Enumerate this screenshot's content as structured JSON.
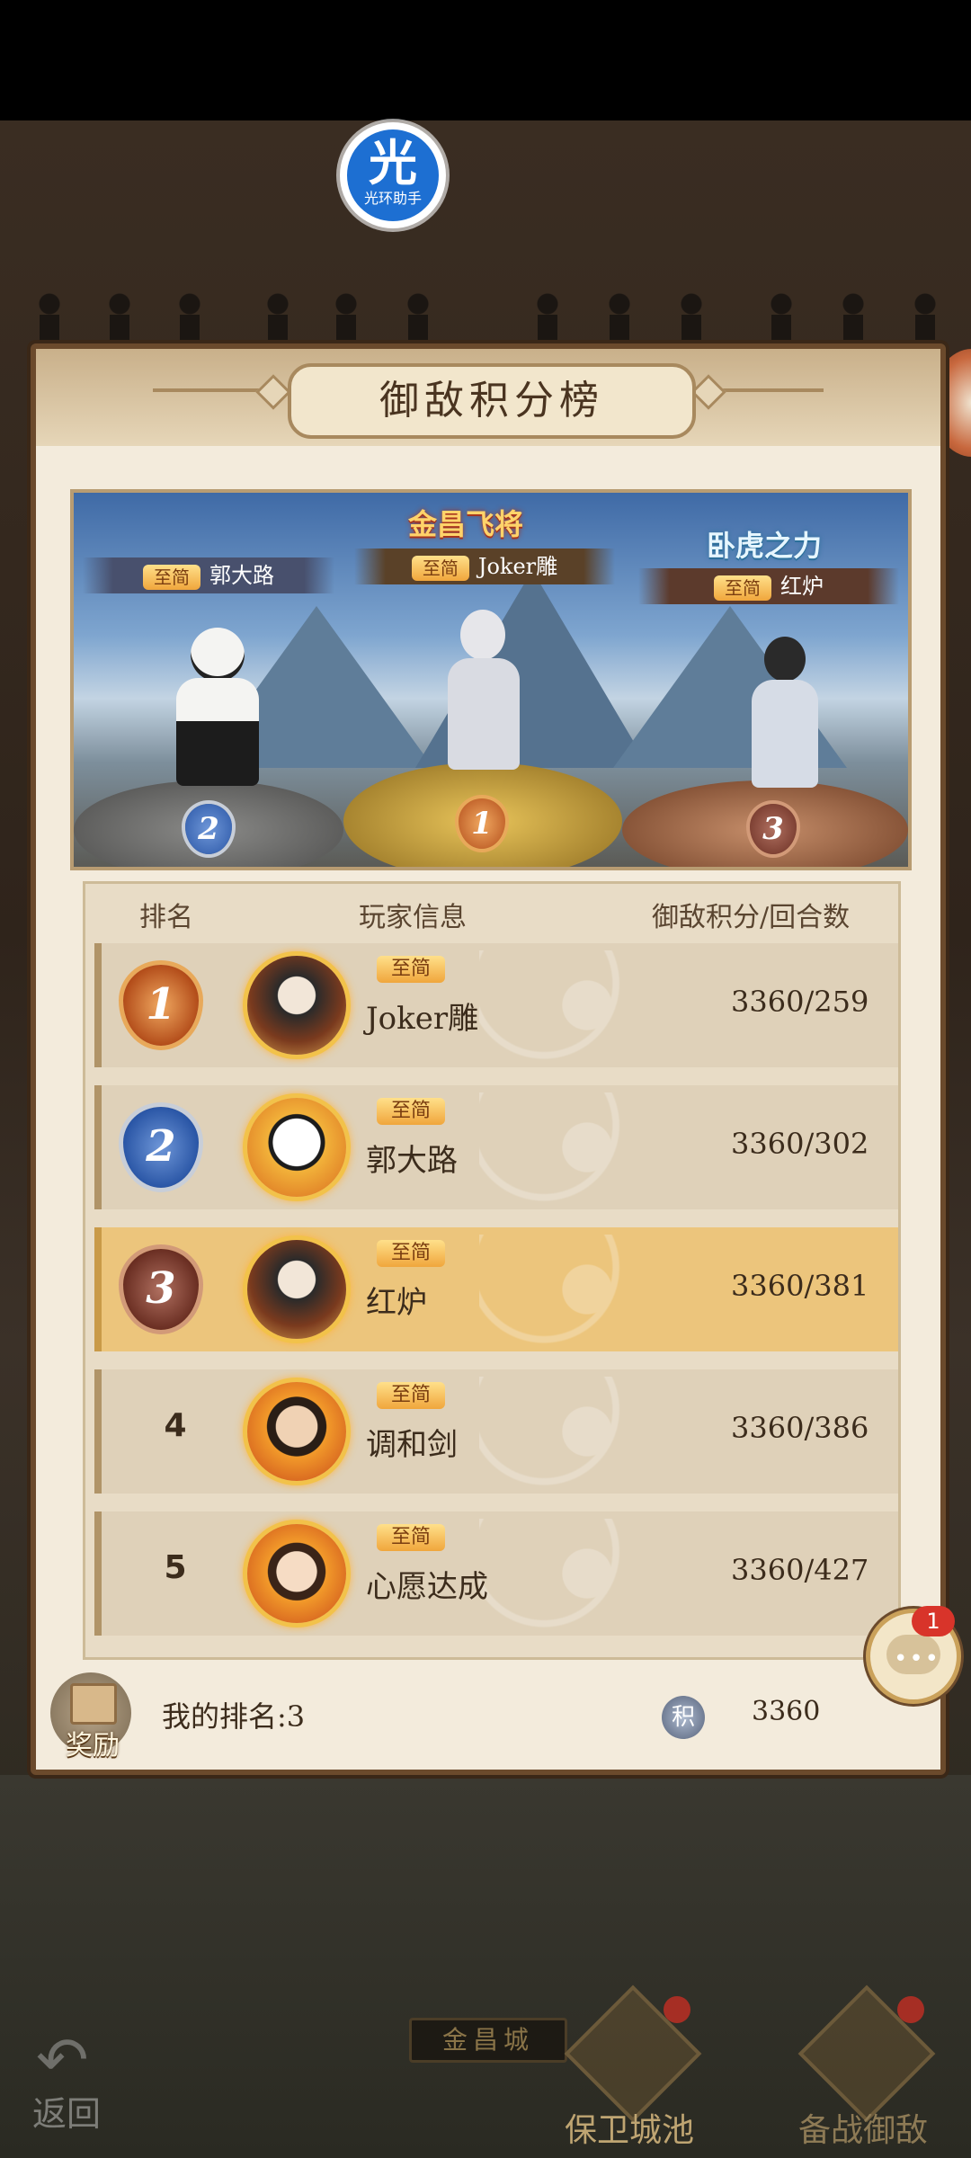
{
  "helper": {
    "glyph": "光",
    "label": "光环助手"
  },
  "panel": {
    "title": "御敌积分榜"
  },
  "podium": {
    "first": {
      "title": "金昌飞将",
      "vip": "至简",
      "name": "Joker雕",
      "rank": "1"
    },
    "second": {
      "vip": "至简",
      "name": "郭大路",
      "rank": "2"
    },
    "third": {
      "title": "卧虎之力",
      "vip": "至简",
      "name": "红炉",
      "rank": "3"
    }
  },
  "table": {
    "headers": {
      "rank": "排名",
      "player": "玩家信息",
      "score": "御敌积分/回合数"
    },
    "rows": [
      {
        "rank": "1",
        "vip": "至简",
        "name": "Joker雕",
        "score": "3360/259"
      },
      {
        "rank": "2",
        "vip": "至简",
        "name": "郭大路",
        "score": "3360/302"
      },
      {
        "rank": "3",
        "vip": "至简",
        "name": "红炉",
        "score": "3360/381"
      },
      {
        "rank": "4",
        "vip": "至简",
        "name": "调和剑",
        "score": "3360/386"
      },
      {
        "rank": "5",
        "vip": "至简",
        "name": "心愿达成",
        "score": "3360/427"
      }
    ]
  },
  "footer": {
    "reward_label": "奖励",
    "my_rank": "我的排名:3",
    "score_icon_glyph": "积",
    "my_score": "3360"
  },
  "chat": {
    "badge": "1",
    "icon": "chat-bubble-icon"
  },
  "city": {
    "plaque": "金昌城"
  },
  "nav": {
    "back": "返回",
    "defend": "保卫城池",
    "prepare": "备战御敌"
  },
  "colors": {
    "panel_bg": "#f3ebdc",
    "highlight_row": "#ecc57c",
    "vip_tag": "#f0a63c",
    "badge_red": "#d8342a"
  }
}
